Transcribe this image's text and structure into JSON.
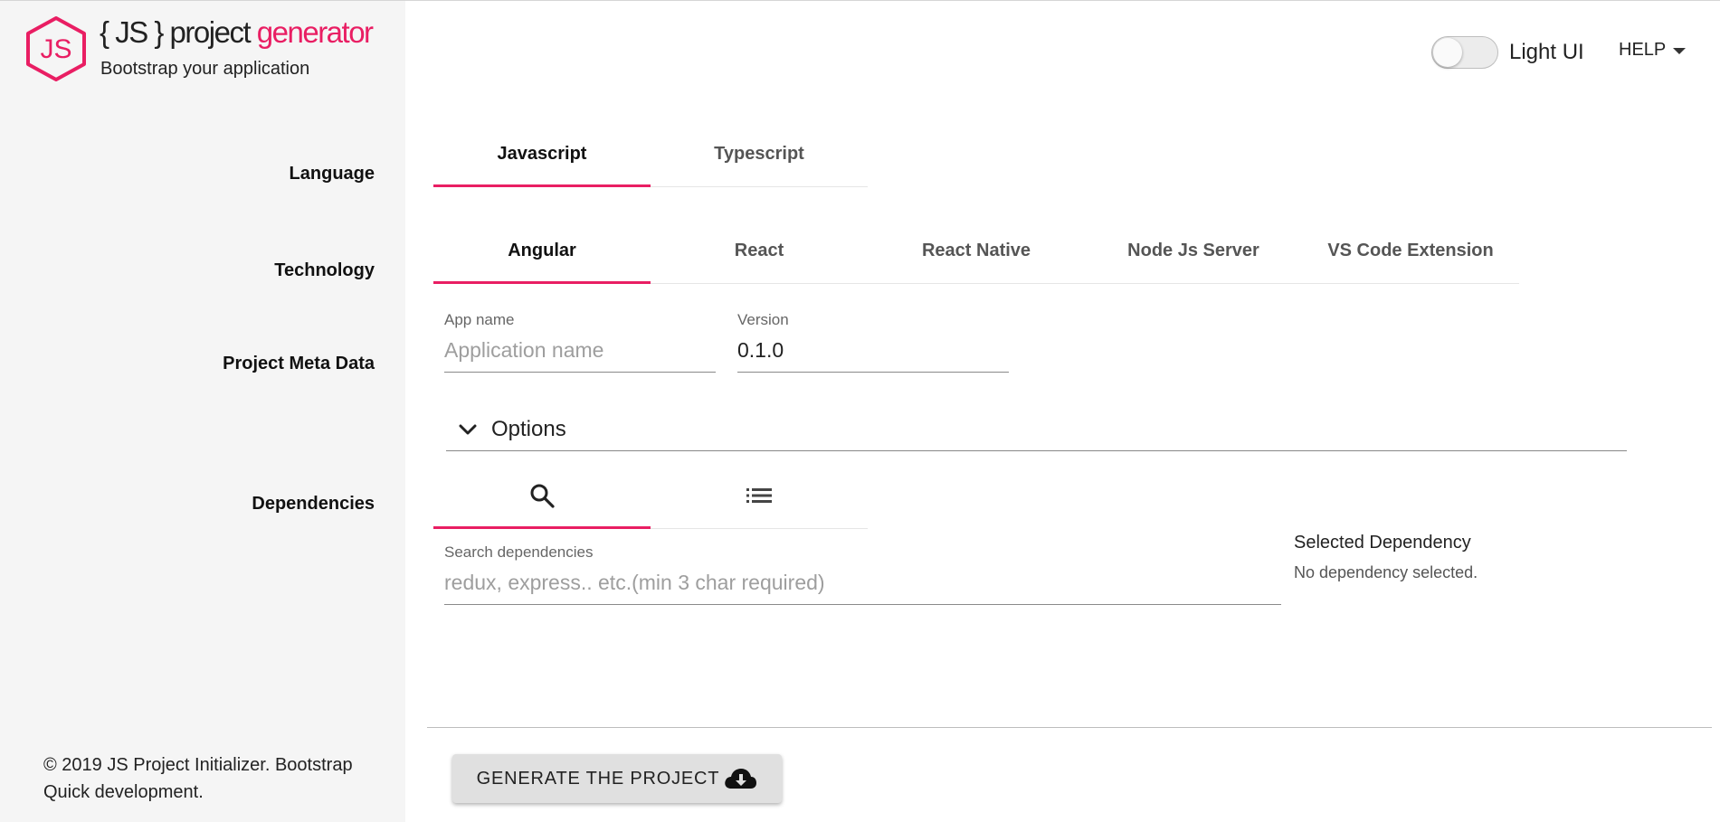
{
  "brand": {
    "title_prefix": "{ JS } project ",
    "title_accent": "generator",
    "subtitle": "Bootstrap your application",
    "logo_text": "JS",
    "accent_color": "#e91e63"
  },
  "header": {
    "toggle_label": "Light UI",
    "toggle_on": false,
    "help_label": "HELP"
  },
  "sections": {
    "language": "Language",
    "technology": "Technology",
    "meta": "Project Meta Data",
    "dependencies": "Dependencies"
  },
  "language_tabs": [
    {
      "label": "Javascript",
      "active": true
    },
    {
      "label": "Typescript",
      "active": false
    }
  ],
  "technology_tabs": [
    {
      "label": "Angular",
      "active": true
    },
    {
      "label": "React",
      "active": false
    },
    {
      "label": "React Native",
      "active": false
    },
    {
      "label": "Node Js Server",
      "active": false
    },
    {
      "label": "VS Code Extension",
      "active": false
    }
  ],
  "meta": {
    "app_name_label": "App name",
    "app_name_placeholder": "Application name",
    "app_name_value": "",
    "version_label": "Version",
    "version_value": "0.1.0"
  },
  "options": {
    "label": "Options",
    "icon": "chevron-down-icon"
  },
  "dependency_tabs": [
    {
      "icon": "search-icon",
      "active": true
    },
    {
      "icon": "list-icon",
      "active": false
    }
  ],
  "dependencies": {
    "search_label": "Search dependencies",
    "search_placeholder": "redux, express.. etc.(min 3 char required)",
    "selected_title": "Selected Dependency",
    "selected_empty": "No dependency selected."
  },
  "footer": {
    "text": "© 2019 JS Project Initializer. Bootstrap Quick development."
  },
  "actions": {
    "generate_label": "GENERATE THE PROJECT",
    "generate_icon": "cloud-download-icon"
  }
}
